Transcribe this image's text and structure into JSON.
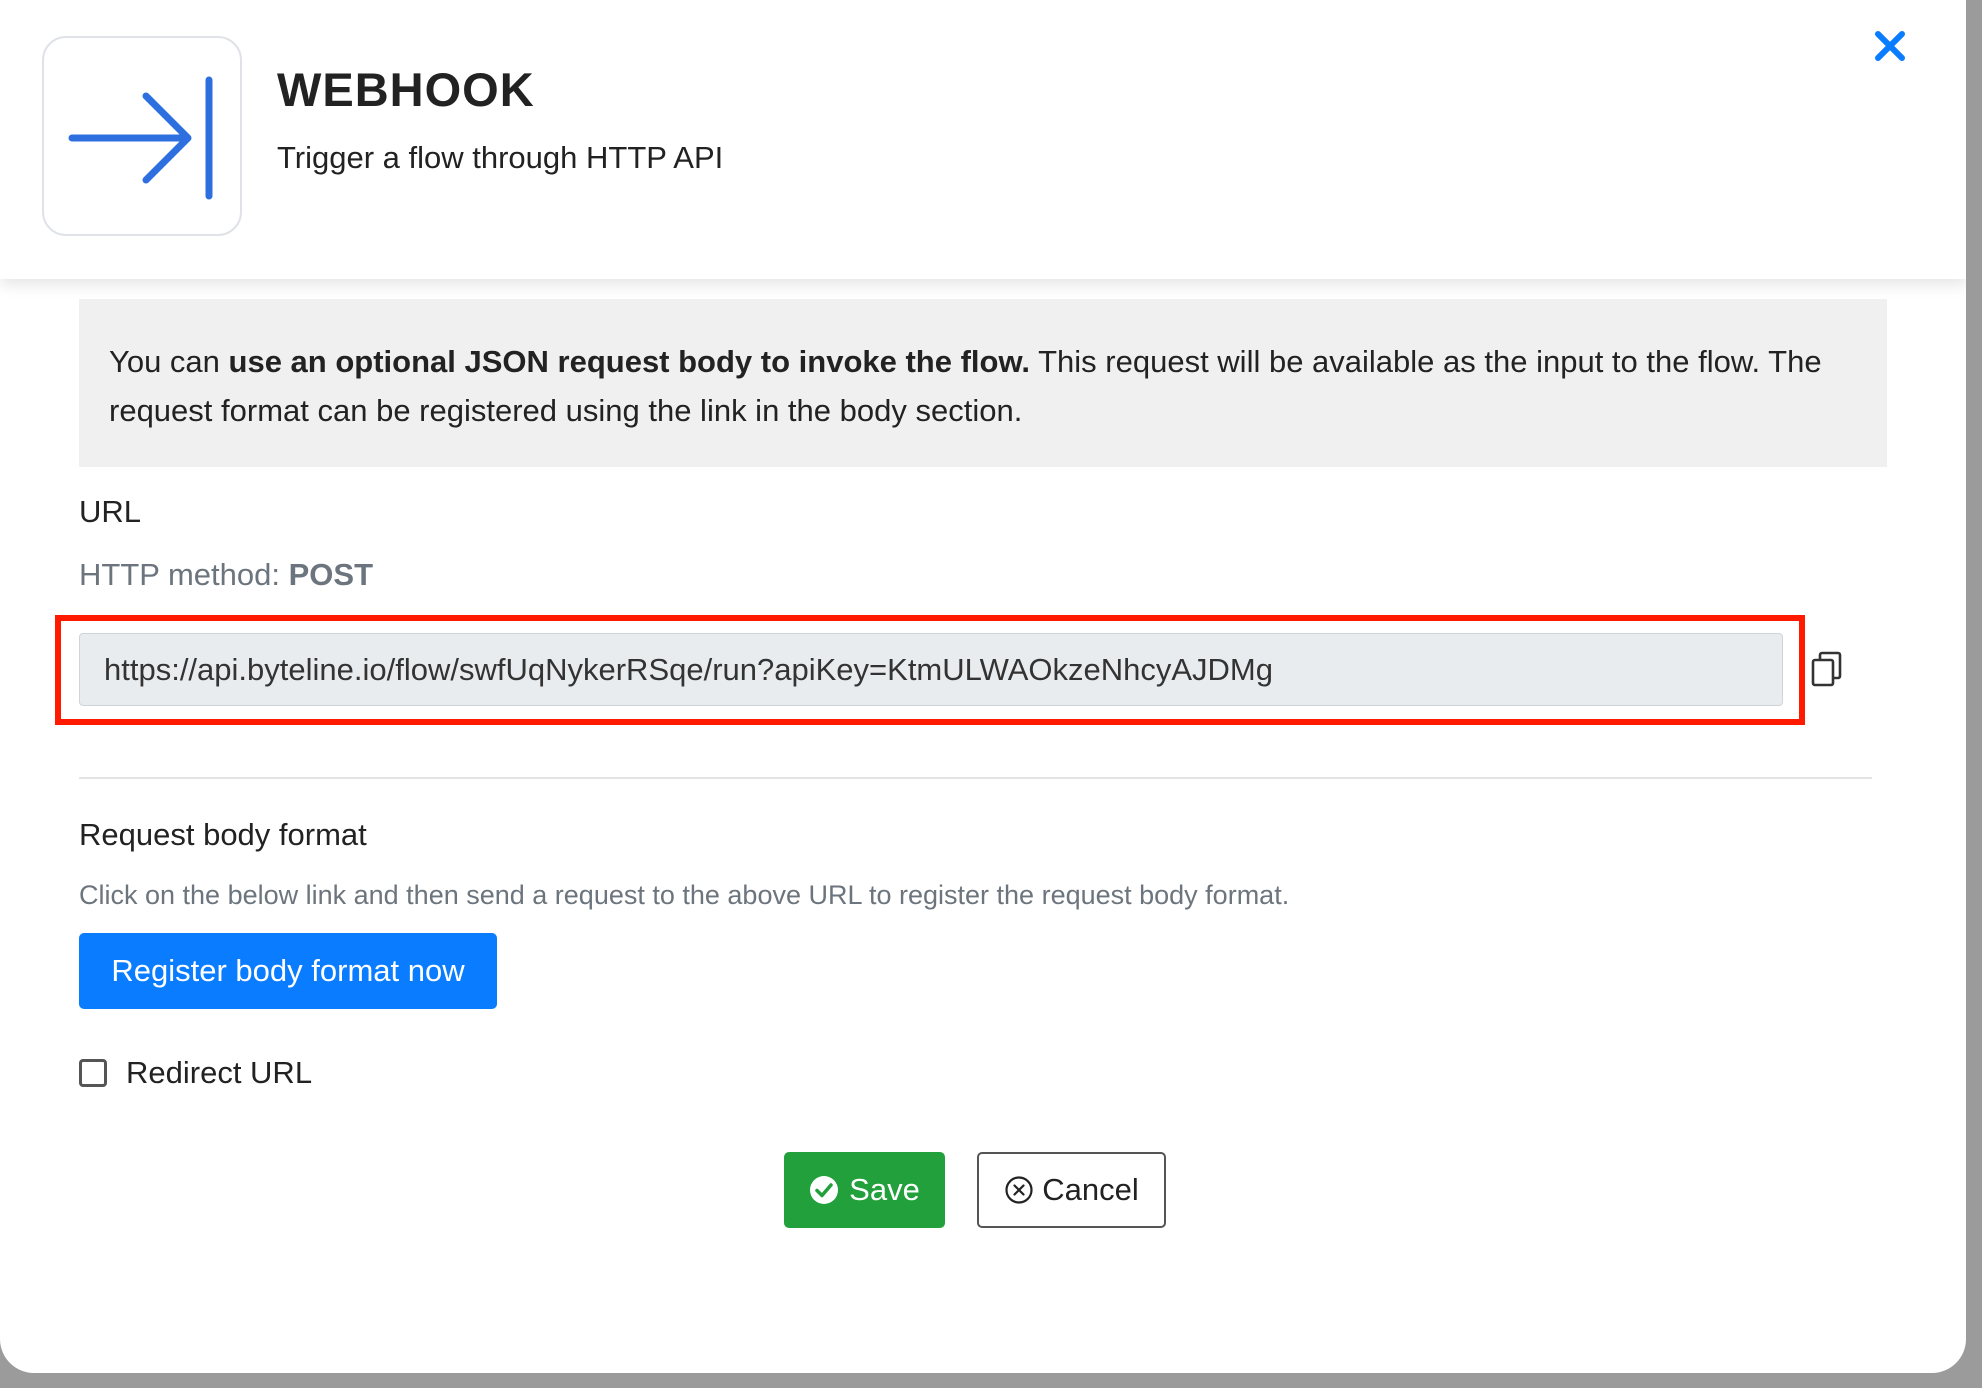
{
  "header": {
    "title": "WEBHOOK",
    "subtitle": "Trigger a flow through HTTP API",
    "logo_icon": "arrow-right-to-bar-icon",
    "close_icon": "close-icon"
  },
  "info": {
    "prefix": "You can ",
    "bold": "use an optional JSON request body to invoke the flow.",
    "suffix": " This request will be available as the input to the flow. The request format can be registered using the link in the body section."
  },
  "url_section": {
    "label": "URL",
    "method_prefix": "HTTP method: ",
    "method_value": "POST",
    "url_value": "https://api.byteline.io/flow/swfUqNykerRSqe/run?apiKey=KtmULWAOkzeNhcyAJDMg",
    "copy_icon": "copy-icon"
  },
  "request_body": {
    "title": "Request body format",
    "description": "Click on the below link and then send a request to the above URL to register the request body format.",
    "button_label": "Register body format now"
  },
  "redirect": {
    "label": "Redirect URL",
    "checked": false
  },
  "footer": {
    "save_label": "Save",
    "cancel_label": "Cancel",
    "save_icon": "check-circle-icon",
    "cancel_icon": "x-circle-icon"
  },
  "colors": {
    "accent": "#0a7cff",
    "icon_blue": "#2e6fe0",
    "save_green": "#21a03c",
    "highlight_red": "#ff1a00",
    "info_bg": "#f0f0f0"
  }
}
